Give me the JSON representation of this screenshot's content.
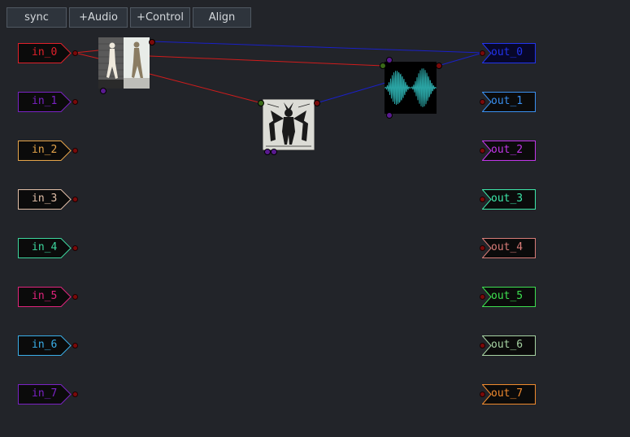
{
  "toolbar": {
    "sync_label": "sync",
    "audio_label": "+Audio",
    "control_label": "+Control",
    "align_label": "Align"
  },
  "inputs": [
    {
      "label": "in_0",
      "color": "#e0202a",
      "fill": "#0b0b0b"
    },
    {
      "label": "in_1",
      "color": "#7a22c4",
      "fill": "#0b0b0b"
    },
    {
      "label": "in_2",
      "color": "#e6a54a",
      "fill": "#0b0b0b"
    },
    {
      "label": "in_3",
      "color": "#e2bfa8",
      "fill": "#0b0b0b"
    },
    {
      "label": "in_4",
      "color": "#3dd79e",
      "fill": "#0b0b0b"
    },
    {
      "label": "in_5",
      "color": "#e0247c",
      "fill": "#0b0b0b"
    },
    {
      "label": "in_6",
      "color": "#3aaee8",
      "fill": "#0b0b0b"
    },
    {
      "label": "in_7",
      "color": "#7a22c4",
      "fill": "#0b0b0b"
    }
  ],
  "outputs": [
    {
      "label": "out_0",
      "color": "#2233ee",
      "fill": "#07072a"
    },
    {
      "label": "out_1",
      "color": "#3a90f0",
      "fill": "#0b0b0b"
    },
    {
      "label": "out_2",
      "color": "#c236ea",
      "fill": "#0b0b0b"
    },
    {
      "label": "out_3",
      "color": "#3de8aa",
      "fill": "#0b0b0b"
    },
    {
      "label": "out_4",
      "color": "#d87c78",
      "fill": "#0b0b0b"
    },
    {
      "label": "out_5",
      "color": "#3ee050",
      "fill": "#0b0b0b"
    },
    {
      "label": "out_6",
      "color": "#a8d4a4",
      "fill": "#0b0b0b"
    },
    {
      "label": "out_7",
      "color": "#f08a2e",
      "fill": "#0b0b0b"
    }
  ],
  "wire_colors": {
    "audio": "#d01c1c",
    "control": "#1a20c8"
  },
  "nodes": {
    "walkers": {
      "icon": "walking-figures-image-icon"
    },
    "devil": {
      "icon": "devil-woodcut-image-icon"
    },
    "waveform": {
      "icon": "waveform-scope-icon",
      "wave_color": "#2aa5a5"
    }
  }
}
